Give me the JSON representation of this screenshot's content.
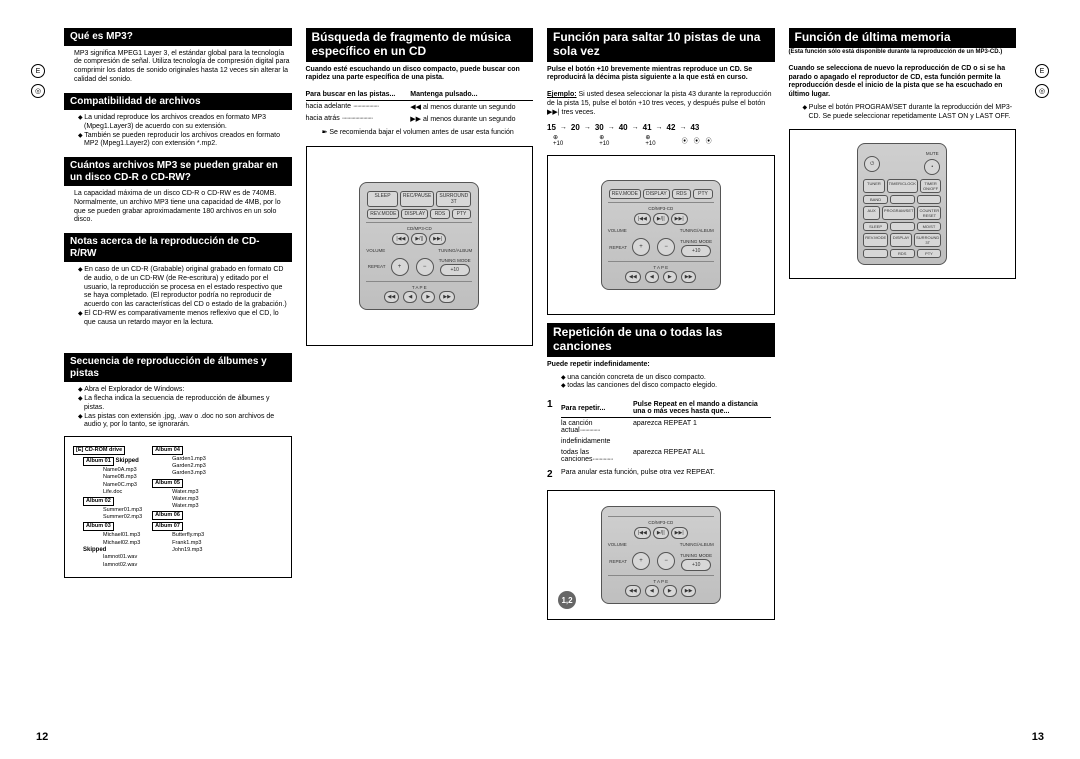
{
  "margin": {
    "e": "E",
    "disc": "◎"
  },
  "col1": {
    "h1": "Qué es MP3?",
    "p1": "MP3 significa MPEG1 Layer 3, el estándar global para la tecnología de compresión de señal. Utiliza tecnología de compresión digital para comprimir los datos de sonido originales hasta 12 veces sin alterar la calidad del sonido.",
    "h2": "Compatibilidad de archivos",
    "b2a": "La unidad reproduce los archivos creados en formato MP3 (Mpeg1.Layer3) de acuerdo con su extensión.",
    "b2b": "También se pueden reproducir los archivos creados en formato MP2 (Mpeg1.Layer2) con extensión *.mp2.",
    "h3": "Cuántos archivos MP3 se pueden grabar en un disco CD-R o CD-RW?",
    "p3a": "La capacidad máxima de un disco CD-R o CD-RW es de 740MB.",
    "p3b": "Normalmente, un archivo MP3 tiene una capacidad de 4MB, por lo que se pueden grabar aproximadamente 180 archivos en un solo disco.",
    "h4": "Notas acerca de la reproducción de CD-R/RW",
    "b4a": "En caso de un CD-R (Grabable) original grabado en formato CD de audio, o de un CD-RW (de Re-escritura) y editado por el usuario, la reproducción se procesa en el estado respectivo que se haya completado. (El reproductor podría no reproducir de acuerdo con las características del CD o estado de la grabación.)",
    "b4b": "El CD-RW es comparativamente menos reflexivo que el CD, lo que causa un retardo mayor en la lectura.",
    "h5": "Secuencia de reproducción de álbumes y pistas",
    "b5a": "Abra el Explorador de Windows:",
    "b5b": "La flecha indica la secuencia de reproducción de álbumes y pistas.",
    "b5c": "Las pistas con extensión .jpg, .wav o .doc no son archivos de audio y, por lo tanto, se ignorarán.",
    "tree": {
      "root": "[E] CD-ROM drive",
      "a1": "Album 01",
      "a1f": [
        "Name0A.mp3",
        "Name0B.mp3",
        "Name0C.mp3",
        "Life.doc"
      ],
      "a1s": "Skipped",
      "a2": "Album 02",
      "a3": "Album 03",
      "a3f": [
        "Michael01.mp3",
        "Michael02.mp3"
      ],
      "a3s": "Skipped",
      "a3sf": [
        "Iamnot01.wav",
        "Iamnot02.wav"
      ],
      "a4": "Album 04",
      "a4f": [
        "Garden1.mp3",
        "Garden2.mp3",
        "Garden3.mp3"
      ],
      "a5": "Album 05",
      "a5f": [
        "Water.mp3",
        "Water.mp3",
        "Water.mp3"
      ],
      "a6": "Album 06",
      "a7": "Album 07",
      "a7f": [
        "Butterfly.mp3",
        "Frank1.mp3",
        "John19.mp3"
      ],
      "sub": [
        "Summer01.mp3",
        "Summer02.mp3"
      ]
    }
  },
  "col2": {
    "h1": "Búsqueda de fragmento de música específico en un CD",
    "p1": "Cuando esté escuchando un disco compacto, puede buscar con rapidez una parte específica de una pista.",
    "th1": "Para buscar en las pistas...",
    "th2": "Mantenga pulsado...",
    "r1a": "hacia adelante",
    "r1b": "◀◀ al menos durante un segundo",
    "r2a": "hacia atrás",
    "r2b": "▶▶ al menos durante un segundo",
    "note": "Se recomienda bajar el volumen antes de usar esta función",
    "remote": {
      "row1": [
        "SLEEP",
        "REC/PAUSE",
        "SURROUND 3T"
      ],
      "row2": [
        "REV.MODE",
        "DISPLAY",
        "RDS",
        "PTY"
      ],
      "lbl": "CD/MP3-CD",
      "nav": [
        "|◀◀",
        "▶/||",
        "▶▶|"
      ],
      "vol": "VOLUME",
      "tun": "TUNING/ALBUM",
      "plus": "+",
      "minus": "−",
      "rep": "REPEAT",
      "mode": "TUNING MODE",
      "plus10": "+10",
      "tape": "T A P E",
      "tapebtns": [
        "◀◀",
        "◀",
        "▶",
        "▶▶"
      ]
    }
  },
  "col3": {
    "h1": "Función para saltar 10 pistas de una sola vez",
    "p1": "Pulse el botón +10 brevemente mientras reproduce un CD. Se reproducirá la décima pista siguiente a la que está en curso.",
    "ex_l": "Ejemplo:",
    "ex": "Si usted desea seleccionar la pista 43 durante la reproducción de la pista 15, pulse el botón +10 tres veces, y después pulse el botón ▶▶| tres veces.",
    "seq": [
      "15",
      "20",
      "30",
      "40",
      "41",
      "42",
      "43"
    ],
    "seq_sub": [
      "+10",
      "+10",
      "+10"
    ],
    "h2": "Repetición de una o todas las canciones",
    "lead": "Puede repetir indefinidamente:",
    "b2a": "una canción concreta de un disco compacto.",
    "b2b": "todas las canciones del disco compacto elegido.",
    "step1_l": "Para repetir...",
    "step1_r": "Pulse Repeat en el mando a distancia una o más veces hasta que...",
    "s1a_l": "la canción actual",
    "s1a_r": "aparezca REPEAT 1",
    "s1b_l": "indefinidamente",
    "s1c_l": "todas las canciones",
    "s1c_r": "aparezca REPEAT ALL",
    "step2": "Para anular esta función, pulse otra vez REPEAT.",
    "badge": "1,2"
  },
  "col4": {
    "h1": "Función de última memoria",
    "sub": "(Esta función sólo está disponible durante la reproducción de un MP3-CD.)",
    "p1": "Cuando se selecciona de nuevo la reproducción de CD o si se ha parado o apagado el reproductor de CD, esta función permite la reproducción desde el inicio de la pista que se ha escuchado en último lugar.",
    "b1": "Pulse el botón PROGRAM/SET durante la reproducción del MP3-CD. Se puede seleccionar repetidamente LAST ON y LAST OFF.",
    "remote": {
      "pwr": "⏻",
      "mute": "MUTE",
      "row1": [
        "TUNER",
        "TIMER/CLOCK",
        "TIMER ON/OFF"
      ],
      "row1b": [
        "BAND",
        "",
        ""
      ],
      "row2": [
        "AUX",
        "PROGRAM/SET",
        "COUNTER RESET"
      ],
      "row3": [
        "SLEEP",
        "",
        "MO/ST"
      ],
      "row4": [
        "REV.MODE",
        "DISPLAY",
        "SURROUND 3T"
      ],
      "row5": [
        "",
        "RDS",
        "PTY"
      ]
    }
  },
  "pages": {
    "l": "12",
    "r": "13"
  }
}
